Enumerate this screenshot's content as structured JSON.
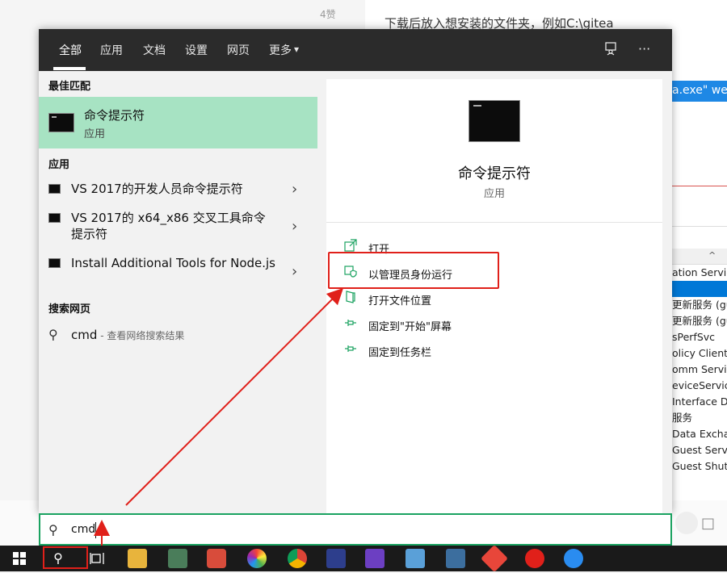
{
  "background": {
    "likes": "4赞",
    "article_line": "下载后放入想安装的文件夹，例如C:\\gitea",
    "selected_snippet": "a.exe\" we",
    "services_rows": [
      "ation Service",
      "",
      "更新服务 (gu",
      "更新服务 (gu",
      "sPerfSvc",
      "olicy Client",
      "omm Servic",
      "eviceServic",
      "Interface De",
      "服务",
      "Data Excha",
      "Guest Serv",
      "Guest Shut"
    ]
  },
  "tabs": [
    "全部",
    "应用",
    "文档",
    "设置",
    "网页",
    "更多"
  ],
  "tab_more_caret": "▾",
  "best_match": {
    "section": "最佳匹配",
    "name": "命令提示符",
    "type": "应用"
  },
  "apps": {
    "section": "应用",
    "items": [
      "VS 2017的开发人员命令提示符",
      "VS 2017的 x64_x86 交叉工具命令提示符",
      "Install Additional Tools for Node.js"
    ]
  },
  "web": {
    "section": "搜索网页",
    "query": "cmd",
    "hint": " - 查看网络搜索结果"
  },
  "detail": {
    "title": "命令提示符",
    "subtitle": "应用",
    "actions": [
      "打开",
      "以管理员身份运行",
      "打开文件位置",
      "固定到\"开始\"屏幕",
      "固定到任务栏"
    ]
  },
  "search": {
    "value": "cmd"
  },
  "icons": {
    "search": "search-icon",
    "feedback": "feedback-icon",
    "more": "more-options-icon",
    "chevron": "chevron-right-icon"
  },
  "colors": {
    "accent_green": "#1aa260",
    "best_match_bg": "#a7e3c3",
    "highlight_red": "#e0201a",
    "topbar_bg": "#2b2b2b"
  }
}
